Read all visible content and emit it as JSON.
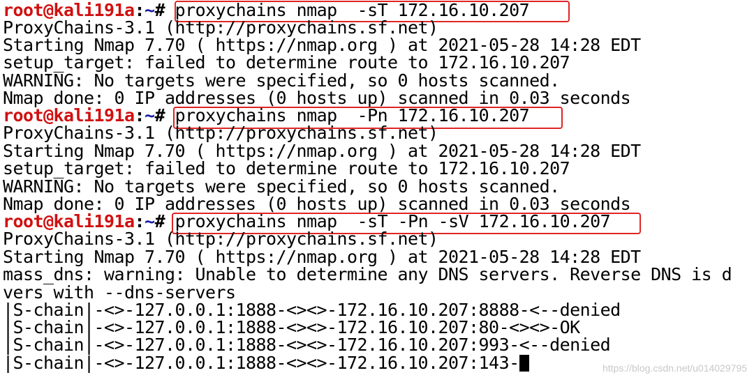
{
  "prompt": {
    "user": "root@kali191a",
    "sep": ":",
    "path": "~",
    "symbol": "# "
  },
  "commands": [
    "proxychains nmap  -sT 172.16.10.207",
    "proxychains nmap  -Pn 172.16.10.207",
    "proxychains nmap  -sT -Pn -sV 172.16.10.207"
  ],
  "output": [
    "ProxyChains-3.1 (http://proxychains.sf.net)",
    "Starting Nmap 7.70 ( https://nmap.org ) at 2021-05-28 14:28 EDT",
    "setup_target: failed to determine route to 172.16.10.207",
    "WARNING: No targets were specified, so 0 hosts scanned.",
    "Nmap done: 0 IP addresses (0 hosts up) scanned in 0.03 seconds",
    "ProxyChains-3.1 (http://proxychains.sf.net)",
    "Starting Nmap 7.70 ( https://nmap.org ) at 2021-05-28 14:28 EDT",
    "setup_target: failed to determine route to 172.16.10.207",
    "WARNING: No targets were specified, so 0 hosts scanned.",
    "Nmap done: 0 IP addresses (0 hosts up) scanned in 0.03 seconds",
    "ProxyChains-3.1 (http://proxychains.sf.net)",
    "Starting Nmap 7.70 ( https://nmap.org ) at 2021-05-28 14:28 EDT",
    "mass_dns: warning: Unable to determine any DNS servers. Reverse DNS is d",
    "vers with --dns-servers",
    "|S-chain|-<>-127.0.0.1:1888-<><>-172.16.10.207:8888-<--denied",
    "|S-chain|-<>-127.0.0.1:1888-<><>-172.16.10.207:80-<><>-OK",
    "|S-chain|-<>-127.0.0.1:1888-<><>-172.16.10.207:993-<--denied",
    "|S-chain|-<>-127.0.0.1:1888-<><>-172.16.10.207:143-"
  ],
  "watermark": "https://blog.csdn.net/u014029795",
  "colors": {
    "prompt_user": "#d01010",
    "prompt_path": "#1a1aa6",
    "highlight_box": "#e02424",
    "text": "#000000",
    "background": "#ffffff"
  }
}
